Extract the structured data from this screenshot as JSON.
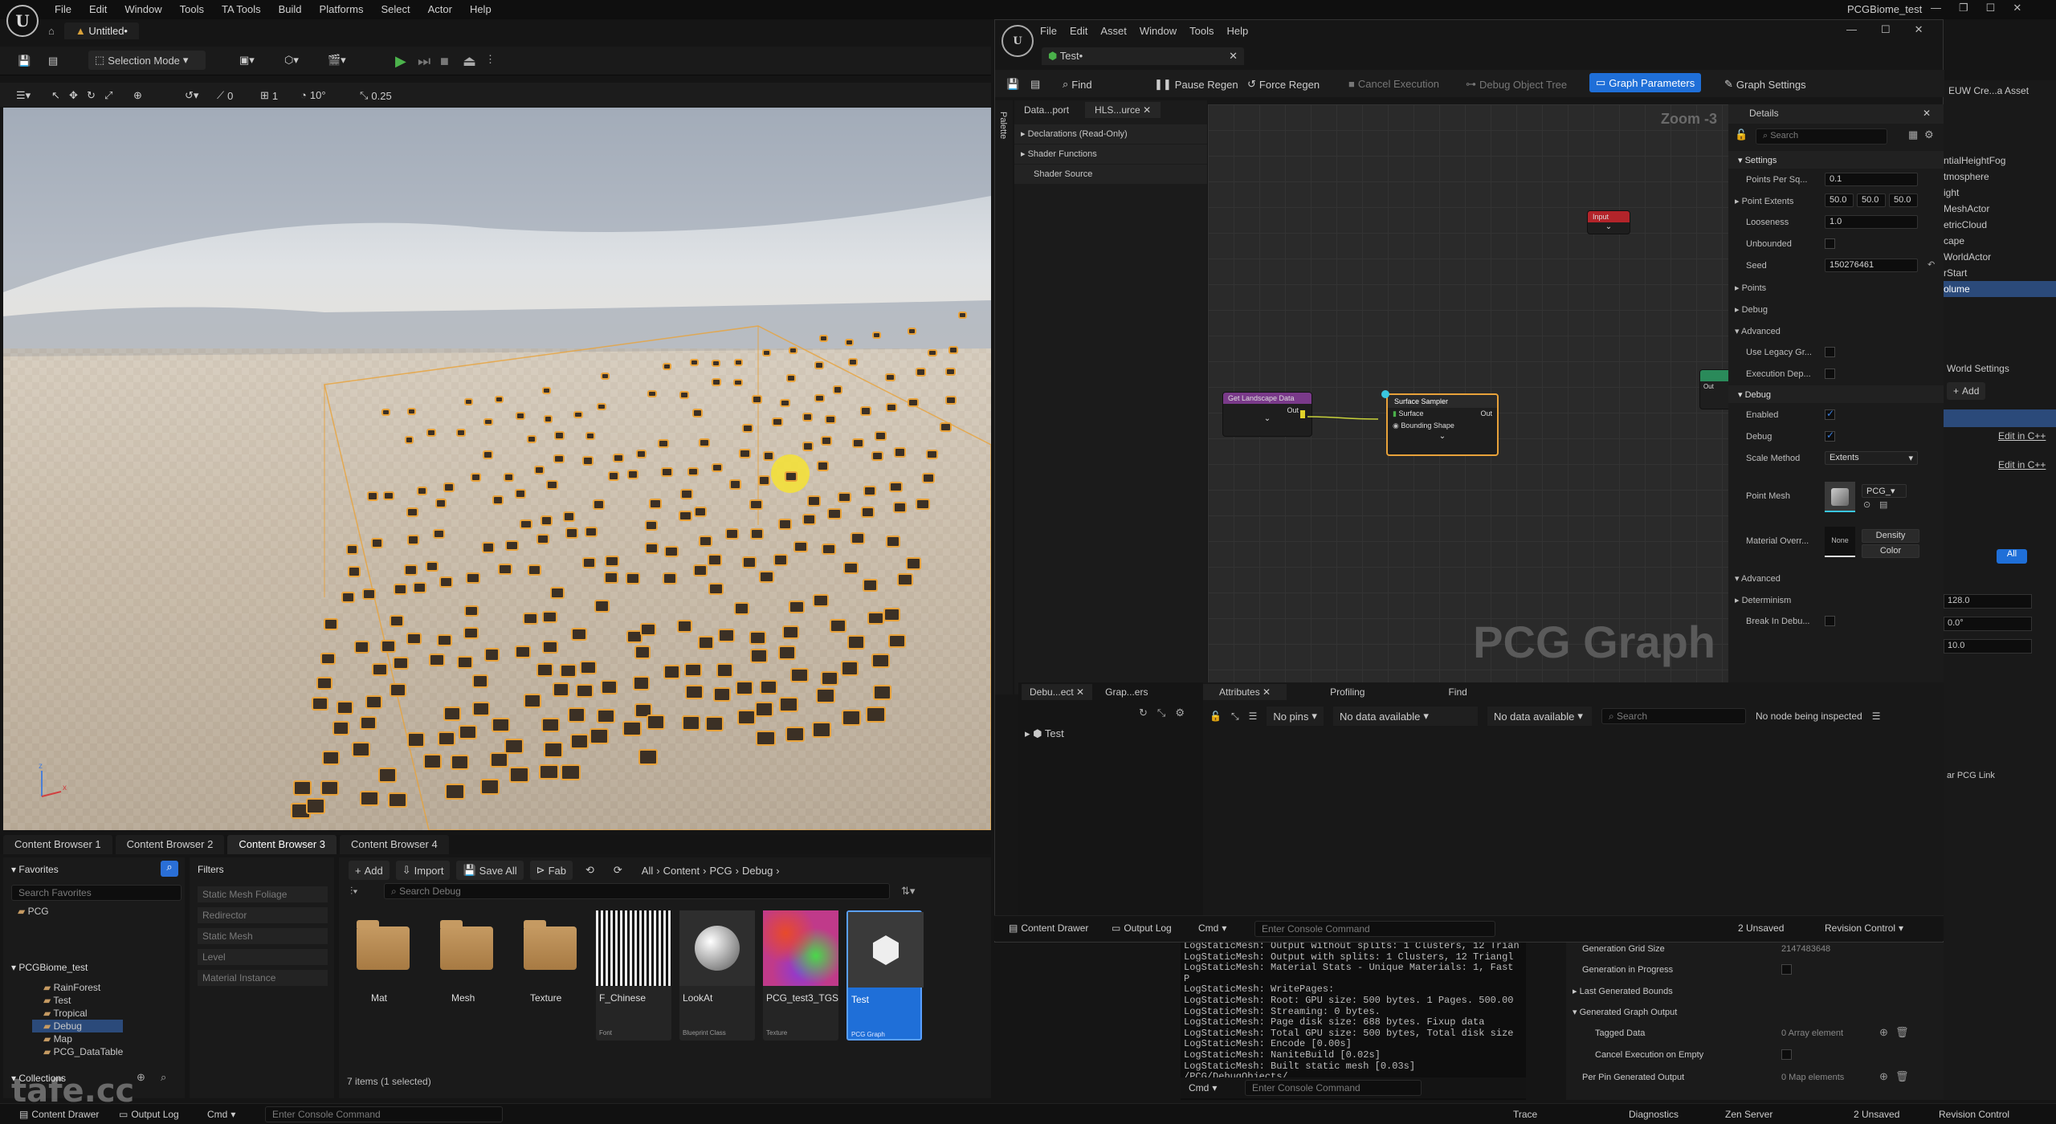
{
  "app": {
    "window_title": "PCGBiome_test",
    "doc_tab": "Untitled•"
  },
  "main_menu": [
    "File",
    "Edit",
    "Window",
    "Tools",
    "TA Tools",
    "Build",
    "Platforms",
    "Select",
    "Actor",
    "Help"
  ],
  "toolbar": {
    "selection_mode": "Selection Mode"
  },
  "viewport_bar": {
    "snap_rot": "10°",
    "snap_scale": "0.25",
    "snap_grid": "1",
    "snap_a": "0"
  },
  "content_tabs": [
    "Content Browser 1",
    "Content Browser 2",
    "Content Browser 3",
    "Content Browser 4"
  ],
  "cb": {
    "add": "Add",
    "import": "Import",
    "save_all": "Save All",
    "fab": "Fab",
    "path": [
      "All",
      "Content",
      "PCG",
      "Debug"
    ],
    "search_placeholder": "Search Debug",
    "favorites": "Favorites",
    "search_favorites": "Search Favorites",
    "fav_item": "PCG",
    "project": "PCGBiome_test",
    "tree": [
      "RainForest",
      "Test",
      "Tropical",
      "Debug",
      "Map",
      "PCG_DataTable"
    ],
    "collections": "Collections",
    "filters": "Filters",
    "filter_items": [
      "Static Mesh Foliage",
      "Redirector",
      "Static Mesh",
      "Level",
      "Material Instance"
    ],
    "items_status": "7 items (1 selected)",
    "assets": [
      {
        "name": "Mat",
        "type": ""
      },
      {
        "name": "Mesh",
        "type": ""
      },
      {
        "name": "Texture",
        "type": ""
      },
      {
        "name": "F_Chinese",
        "type": "Font"
      },
      {
        "name": "LookAt",
        "type": "Blueprint Class"
      },
      {
        "name": "PCG_test3_TGS",
        "type": "Texture"
      },
      {
        "name": "Test",
        "type": "PCG Graph"
      }
    ]
  },
  "statusbar": {
    "content_drawer": "Content Drawer",
    "output_log": "Output Log",
    "cmd": "Cmd",
    "console_placeholder": "Enter Console Command",
    "trace": "Trace",
    "diagnostics": "Diagnostics",
    "zen": "Zen Server",
    "unsaved": "2 Unsaved",
    "revision": "Revision Control"
  },
  "pcg": {
    "menu": [
      "File",
      "Edit",
      "Asset",
      "Window",
      "Tools",
      "Help"
    ],
    "tab": "Test•",
    "toolbar": {
      "find": "Find",
      "pause": "Pause Regen",
      "force": "Force Regen",
      "cancel": "Cancel Execution",
      "debug_tree": "Debug Object Tree",
      "params": "Graph Parameters",
      "settings": "Graph Settings"
    },
    "palette": "Palette",
    "left_tabs": [
      "Data...port",
      "HLS...urce"
    ],
    "hlsl_items": [
      "Declarations (Read-Only)",
      "Shader Functions",
      "Shader Source"
    ],
    "zoom": "Zoom -3",
    "watermark": "PCG Graph",
    "nodes": {
      "input": "Input",
      "landscape": "Get Landscape Data",
      "landscape_out": "Out",
      "sampler": "Surface Sampler",
      "sampler_in1": "Surface",
      "sampler_in2": "Bounding Shape",
      "sampler_out": "Out",
      "partial": "Out"
    },
    "details": {
      "title": "Details",
      "search": "Search",
      "sec_settings": "Settings",
      "points_per_sq": "Points Per Sq...",
      "points_per_sq_val": "0.1",
      "point_extents": "Point Extents",
      "ext_x": "50.0",
      "ext_y": "50.0",
      "ext_z": "50.0",
      "looseness": "Looseness",
      "looseness_val": "1.0",
      "unbounded": "Unbounded",
      "seed": "Seed",
      "seed_val": "150276461",
      "points": "Points",
      "debug_sub": "Debug",
      "advanced": "Advanced",
      "use_legacy": "Use Legacy Gr...",
      "exec_dep": "Execution Dep...",
      "sec_debug": "Debug",
      "enabled": "Enabled",
      "debug": "Debug",
      "scale_method": "Scale Method",
      "scale_val": "Extents",
      "point_mesh": "Point Mesh",
      "pcg_mesh": "PCG_",
      "material_ov": "Material Overr...",
      "none": "None",
      "density": "Density",
      "color": "Color",
      "advanced2": "Advanced",
      "determinism": "Determinism",
      "break_debug": "Break In Debu..."
    },
    "bottom": {
      "tab1": "Debu...ect",
      "tab2": "Grap...ers",
      "attributes": "Attributes",
      "profiling": "Profiling",
      "find": "Find",
      "no_pins": "No pins",
      "no_data1": "No data available",
      "no_data2": "No data available",
      "search": "Search",
      "no_node": "No node being inspected",
      "tree_root": "Test"
    },
    "status": {
      "content_drawer": "Content Drawer",
      "output_log": "Output Log",
      "cmd": "Cmd",
      "console": "Enter Console Command",
      "unsaved": "2 Unsaved",
      "revision": "Revision Control"
    }
  },
  "log_lines": [
    "LogStaticMesh:   Output without splits: 1 Clusters, 12 Trian",
    "LogStaticMesh:   Output with splits: 1 Clusters, 12 Triangl",
    "LogStaticMesh: Material Stats - Unique Materials: 1, Fast P",
    "LogStaticMesh: WritePages:",
    "LogStaticMesh:   Root: GPU size: 500 bytes. 1 Pages. 500.00",
    "LogStaticMesh:   Streaming: 0 bytes.",
    "LogStaticMesh:   Page disk size: 688 bytes. Fixup data",
    "LogStaticMesh:   Total GPU size: 500 bytes, Total disk size",
    "LogStaticMesh: Encode [0.00s]",
    "LogStaticMesh: NaniteBuild [0.02s]",
    "LogStaticMesh: Built static mesh [0.03s] /PCG/DebugObjects/"
  ],
  "right_panel": {
    "title": "EUW Cre...a Asset",
    "outliner": [
      "ntialHeightFog",
      "tmosphere",
      "ight",
      "MeshActor",
      "etricCloud",
      "cape",
      "WorldActor",
      "rStart",
      "olume"
    ],
    "world_settings": "World Settings",
    "add": "Add",
    "edit_cpp": "Edit in C++",
    "all": "All",
    "v1": "128.0",
    "v2": "0.0°",
    "v3": "10.0",
    "pcg_link": "ar PCG Link"
  },
  "lower_right": {
    "gen_grid": "Generation Grid Size",
    "gen_grid_val": "2147483648",
    "in_progress": "Generation in Progress",
    "last_bounds": "Last Generated Bounds",
    "gen_output": "Generated Graph Output",
    "tagged": "Tagged Data",
    "tagged_val": "0 Array element",
    "cancel_empty": "Cancel Execution on Empty",
    "per_pin": "Per Pin Generated Output",
    "per_pin_val": "0 Map elements"
  },
  "watermark": "tafe.cc"
}
